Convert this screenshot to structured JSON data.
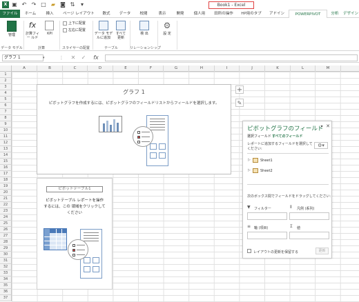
{
  "app": {
    "title": "Book1 - Excel",
    "accent": "#217346"
  },
  "quick_access": {
    "icons": [
      "excel-logo-icon",
      "save-icon",
      "undo-icon",
      "redo-icon",
      "new-file-icon",
      "open-folder-icon",
      "camera-icon",
      "sort-icon",
      "customize-icon"
    ]
  },
  "ribbon": {
    "tabs": [
      "ファイル",
      "ホーム",
      "挿入",
      "ページ レイアウト",
      "数式",
      "データ",
      "校閲",
      "表示",
      "開発",
      "個人用",
      "田所の操作",
      "HP用のタブ",
      "アドイン",
      "POWERPIVOT",
      "分析",
      "デザイン"
    ],
    "selected_tab": "POWERPIVOT",
    "contextual_label": "ピボットグ",
    "groups": {
      "data_model": {
        "label": "データ モデル",
        "manage": "管理"
      },
      "calc": {
        "label": "計算",
        "calc_field": "計算フィー ルド",
        "kpi": "KPI"
      },
      "slicer": {
        "label": "スライサーの配置",
        "align_top": "上下に配置",
        "align_left": "左右に配置"
      },
      "table": {
        "label": "テーブル",
        "add_to_model": "データ モデ ルに追加",
        "update_all": "すべて 更新"
      },
      "relationship": {
        "label": "リレーションシップ",
        "detect": "検 出"
      },
      "settings": {
        "label": "",
        "settings": "設 定"
      }
    }
  },
  "formula_bar": {
    "name_box": "グラフ 1",
    "fx": "fx",
    "content": ""
  },
  "columns": [
    "A",
    "B",
    "C",
    "D",
    "E",
    "F",
    "G",
    "H",
    "I",
    "J",
    "K",
    "L",
    "M"
  ],
  "rows": [
    "1",
    "2",
    "3",
    "4",
    "5",
    "6",
    "7",
    "8",
    "9",
    "10",
    "11",
    "12",
    "13",
    "14",
    "15",
    "16",
    "17",
    "18",
    "19",
    "20",
    "21",
    "22",
    "23",
    "24",
    "25",
    "26",
    "27",
    "28",
    "29",
    "30",
    "31",
    "32",
    "33",
    "34",
    "35",
    "36",
    "37"
  ],
  "chart": {
    "title": "グラフ 1",
    "instruction": "ピボットグラフを作成するには、ピボットグラフのフィールドリストからフィールドを選択します。"
  },
  "pivot_table": {
    "name": "ピボットテーブル1",
    "instruction_line1": "ピボットテーブル レポートを操作",
    "instruction_line2": "するには、この 領域をクリックして",
    "instruction_line3": "ください"
  },
  "field_pane": {
    "title": "ピボットグラフのフィールド",
    "tab_active": "選択フィールド",
    "tab_all": "すべてのフィールド",
    "prompt_line1": "レポートに追加するフィールドを選択して",
    "prompt_line2": "ください:",
    "fields": [
      "Sheet1",
      "Sheet2"
    ],
    "drag_prompt": "次のボックス間でフィールドをドラッグしてください:",
    "areas": [
      "フィルター",
      "凡例 (系列)",
      "軸 (項目)",
      "値"
    ],
    "defer_label": "レイアウトの更新を保留する",
    "update_button": "更新"
  }
}
